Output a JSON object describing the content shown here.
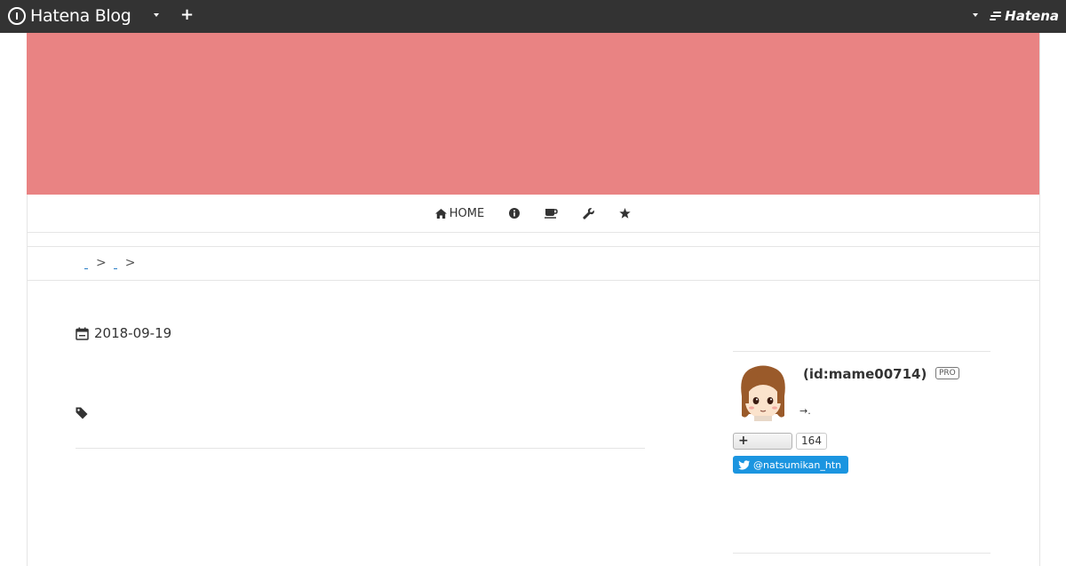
{
  "topbar": {
    "brand": "Hatena Blog",
    "company": "Hatena",
    "icons": [
      "hatena-blog-logo-icon",
      "dropdown-caret-icon",
      "plus-icon",
      "hatena-logo-icon"
    ]
  },
  "header": {
    "background_color": "#e98383"
  },
  "nav": {
    "home_label": "HOME",
    "items": [
      "home-icon",
      "info-icon",
      "coffee-icon",
      "wrench-icon",
      "star-icon"
    ]
  },
  "breadcrumb": {
    "separators": [
      ">",
      ">"
    ]
  },
  "article": {
    "date": "2018-09-19",
    "icons": [
      "calendar-icon",
      "tag-icon"
    ]
  },
  "profile": {
    "id_text": "(id:mame00714)",
    "badge": "PRO",
    "arrow": "→.",
    "subscriber_count": "164",
    "twitter_handle": "@natsumikan_htn",
    "twitter_color": "#1b95e0"
  }
}
